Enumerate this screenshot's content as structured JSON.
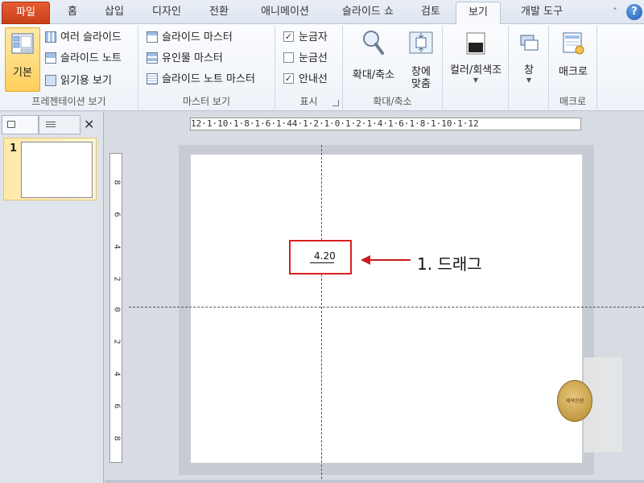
{
  "tabs": [
    {
      "label": "파일"
    },
    {
      "label": "홈"
    },
    {
      "label": "삽입"
    },
    {
      "label": "디자인"
    },
    {
      "label": "전환"
    },
    {
      "label": "애니메이션"
    },
    {
      "label": "슬라이드 쇼"
    },
    {
      "label": "검토"
    },
    {
      "label": "보기"
    },
    {
      "label": "개발 도구"
    }
  ],
  "ribbon": {
    "presentation_views": {
      "label": "프레젠테이션 보기",
      "normal": "기본",
      "slide_sorter": "여러 슬라이드",
      "notes_page": "슬라이드 노트",
      "reading_view": "읽기용 보기"
    },
    "master_views": {
      "label": "마스터 보기",
      "slide_master": "슬라이드 마스터",
      "handout_master": "유인물 마스터",
      "notes_master": "슬라이드 노트 마스터"
    },
    "show": {
      "label": "표시",
      "ruler": "눈금자",
      "gridlines": "눈금선",
      "guides": "안내선",
      "ruler_checked": true,
      "gridlines_checked": false,
      "guides_checked": true
    },
    "zoom": {
      "label": "확대/축소",
      "zoom": "확대/축소",
      "fit_line1": "창에",
      "fit_line2": "맞춤"
    },
    "color": {
      "label": "컬러/회색조"
    },
    "window": {
      "label": "창"
    },
    "macros": {
      "label": "매크로",
      "button": "매크로"
    }
  },
  "slide_panel": {
    "slide_number": "1"
  },
  "ruler": {
    "horizontal": "12·1·10·1·8·1·6·1·44·1·2·1·0·1·2·1·4·1·6·1·8·1·10·1·12",
    "vertical_labels": [
      "8",
      "6",
      "4",
      "2",
      "0",
      "2",
      "4",
      "6",
      "8"
    ]
  },
  "canvas": {
    "guide_readout": "4.20",
    "annotation": "1. 드래그"
  },
  "colors": {
    "file_tab": "#d24a22",
    "highlight": "#d92020",
    "arrow": "#c81e1e"
  }
}
